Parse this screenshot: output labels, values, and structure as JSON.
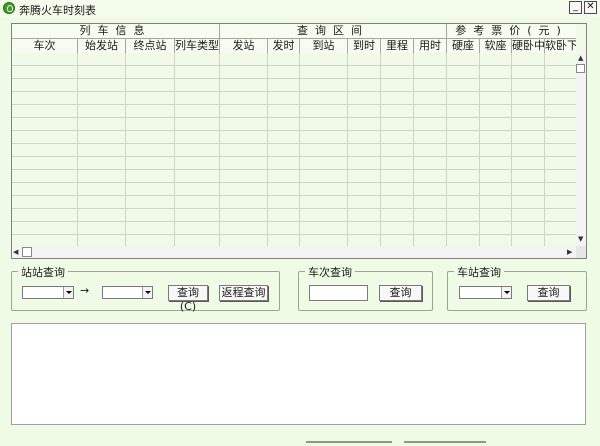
{
  "window": {
    "title": "奔腾火车时刻表",
    "minimize_glyph": "_",
    "close_glyph": "✕"
  },
  "table": {
    "groups": [
      "列车信息",
      "查询区间",
      "参考票价(元)"
    ],
    "columns": [
      "车次",
      "始发站",
      "终点站",
      "列车类型",
      "发站",
      "发时",
      "到站",
      "到时",
      "里程",
      "用时",
      "硬座",
      "软座",
      "硬卧中",
      "软卧下"
    ],
    "rows": []
  },
  "station_query": {
    "label": "站站查询",
    "from_value": "",
    "arrow": "→",
    "to_value": "",
    "query_button": "查询(C)",
    "return_button": "返程查询"
  },
  "train_query": {
    "label": "车次查询",
    "input_value": "",
    "query_button": "查询"
  },
  "stop_query": {
    "label": "车站查询",
    "station_value": "",
    "query_button": "查询"
  },
  "result": {
    "text": ""
  },
  "icons": {
    "app": "train-app-icon",
    "scroll_up": "▲",
    "scroll_down": "▼",
    "scroll_left": "◀",
    "scroll_right": "▶"
  },
  "colors": {
    "background": "#f0fbe5",
    "grid_line": "#cdd7c3"
  }
}
